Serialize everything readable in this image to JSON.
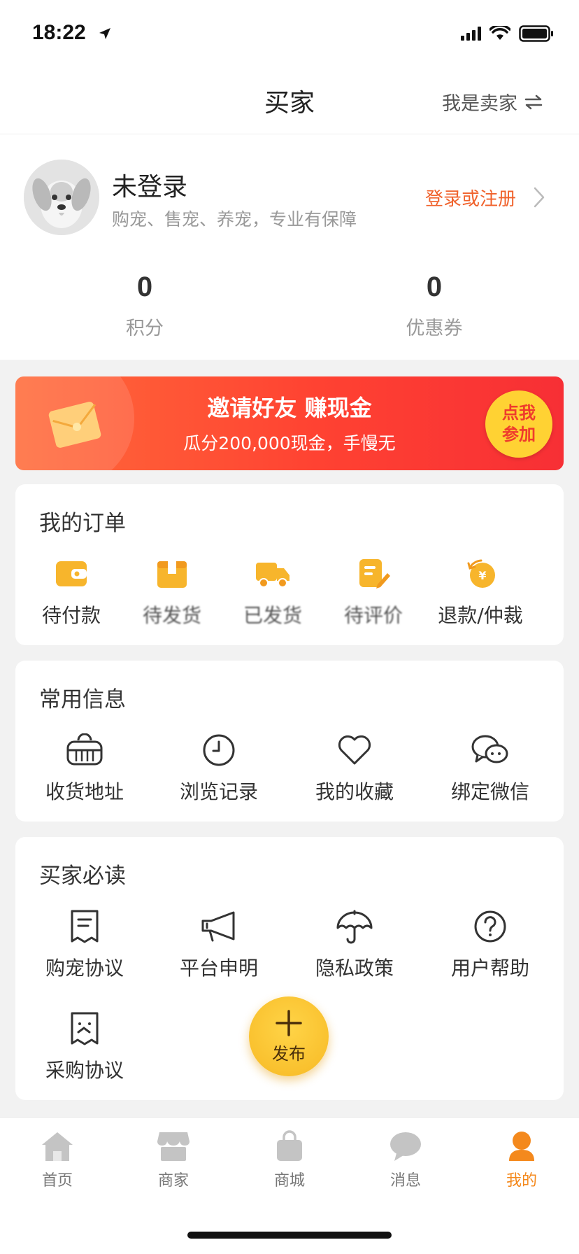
{
  "status_bar": {
    "time": "18:22"
  },
  "header": {
    "title": "买家",
    "switch_label": "我是卖家"
  },
  "profile": {
    "name": "未登录",
    "subtitle": "购宠、售宠、养宠，专业有保障",
    "login_label": "登录或注册",
    "stats": [
      {
        "value": "0",
        "label": "积分"
      },
      {
        "value": "0",
        "label": "优惠券"
      }
    ]
  },
  "banner": {
    "title": "邀请好友 赚现金",
    "subtitle": "瓜分200,000现金，手慢无",
    "button_line1": "点我",
    "button_line2": "参加"
  },
  "orders": {
    "title": "我的订单",
    "items": [
      {
        "label": "待付款",
        "icon": "wallet-icon"
      },
      {
        "label": "待发货",
        "icon": "box-icon"
      },
      {
        "label": "已发货",
        "icon": "truck-icon"
      },
      {
        "label": "待评价",
        "icon": "review-icon"
      },
      {
        "label": "退款/仲裁",
        "icon": "refund-icon"
      }
    ]
  },
  "common_info": {
    "title": "常用信息",
    "items": [
      {
        "label": "收货地址",
        "icon": "pet-carrier-icon"
      },
      {
        "label": "浏览记录",
        "icon": "clock-icon"
      },
      {
        "label": "我的收藏",
        "icon": "heart-icon"
      },
      {
        "label": "绑定微信",
        "icon": "wechat-icon"
      }
    ]
  },
  "must_read": {
    "title": "买家必读",
    "items": [
      {
        "label": "购宠协议",
        "icon": "receipt-icon"
      },
      {
        "label": "平台申明",
        "icon": "megaphone-icon"
      },
      {
        "label": "隐私政策",
        "icon": "umbrella-icon"
      },
      {
        "label": "用户帮助",
        "icon": "question-icon"
      },
      {
        "label": "采购协议",
        "icon": "document-icon"
      }
    ]
  },
  "fab": {
    "label": "发布"
  },
  "tabs": [
    {
      "label": "首页",
      "icon": "home-icon",
      "active": false
    },
    {
      "label": "商家",
      "icon": "store-icon",
      "active": false
    },
    {
      "label": "商城",
      "icon": "shopping-bag-icon",
      "active": false
    },
    {
      "label": "消息",
      "icon": "chat-icon",
      "active": false
    },
    {
      "label": "我的",
      "icon": "user-icon",
      "active": true
    }
  ],
  "colors": {
    "accent": "#f4891d",
    "login_link": "#f0622c",
    "order_icon": "#f7b52c",
    "banner": "#ff4232"
  }
}
